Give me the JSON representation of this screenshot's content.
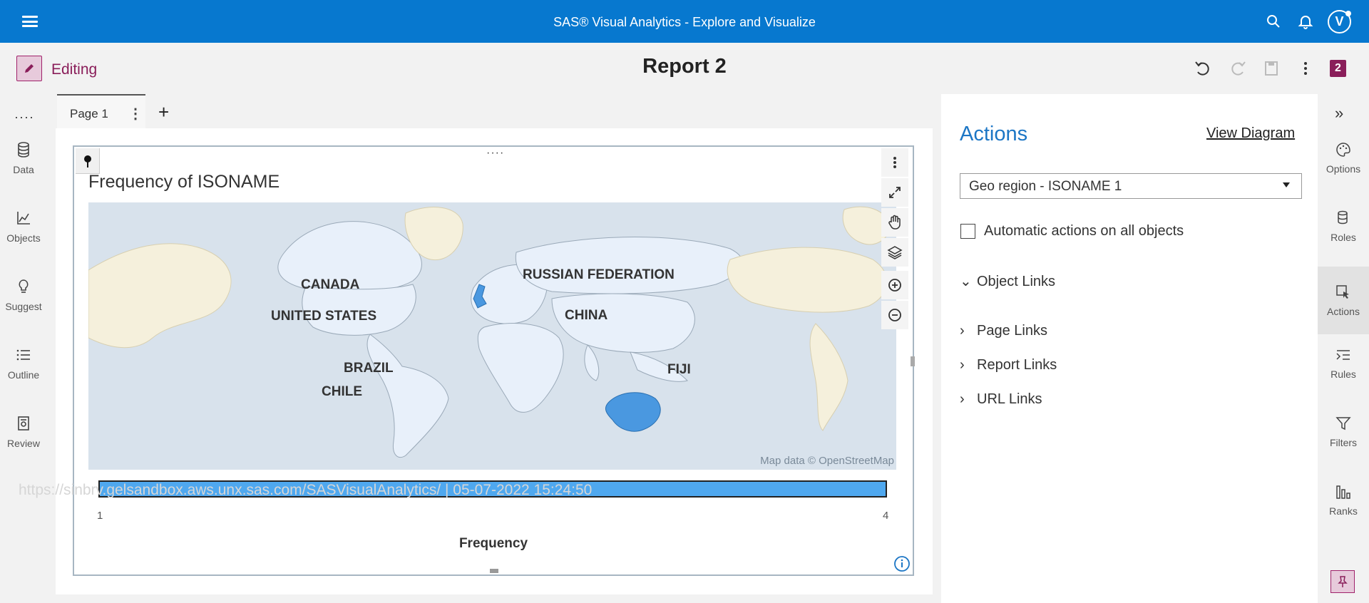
{
  "banner": {
    "title": "SAS® Visual Analytics - Explore and Visualize",
    "avatar_initial": "V"
  },
  "toolbar": {
    "mode_label": "Editing",
    "report_title": "Report 2",
    "badge_count": "2"
  },
  "leftnav": {
    "items": [
      {
        "label": "Data",
        "icon": "database-icon"
      },
      {
        "label": "Objects",
        "icon": "chart-line-icon"
      },
      {
        "label": "Suggest",
        "icon": "lightbulb-icon"
      },
      {
        "label": "Outline",
        "icon": "list-icon"
      },
      {
        "label": "Review",
        "icon": "review-icon"
      }
    ]
  },
  "canvas": {
    "tab_label": "Page 1",
    "viz_title": "Frequency of ISONAME",
    "map_attribution": "Map data © OpenStreetMap",
    "map_labels": [
      "CANADA",
      "UNITED STATES",
      "BRAZIL",
      "CHILE",
      "RUSSIAN FEDERATION",
      "CHINA",
      "FIJI"
    ],
    "legend": {
      "title": "Frequency",
      "min": "1",
      "max": "4"
    },
    "watermark": "https://sinbrv.gelsandbox.aws.unx.sas.com/SASVisualAnalytics/ | 05-07-2022 15:24:50"
  },
  "right_pane": {
    "title": "Actions",
    "view_diagram": "View Diagram",
    "selected_object": "Geo region - ISONAME 1",
    "auto_actions_label": "Automatic actions on all objects",
    "auto_actions_checked": false,
    "sections": [
      {
        "label": "Object Links",
        "expanded": true
      },
      {
        "label": "Page Links",
        "expanded": false
      },
      {
        "label": "Report Links",
        "expanded": false
      },
      {
        "label": "URL Links",
        "expanded": false
      }
    ]
  },
  "right_rail": {
    "items": [
      {
        "label": "Options",
        "icon": "palette-icon"
      },
      {
        "label": "Roles",
        "icon": "roles-icon"
      },
      {
        "label": "Actions",
        "icon": "pointer-icon",
        "active": true
      },
      {
        "label": "Rules",
        "icon": "rules-icon"
      },
      {
        "label": "Filters",
        "icon": "filter-icon"
      },
      {
        "label": "Ranks",
        "icon": "ranks-icon"
      }
    ]
  },
  "colors": {
    "banner": "#0778cf",
    "accent_magenta": "#8a1e5a",
    "legend_fill": "#4fa8ef",
    "highlight_region": "#4a98e0",
    "actions_title": "#1c76c5"
  }
}
